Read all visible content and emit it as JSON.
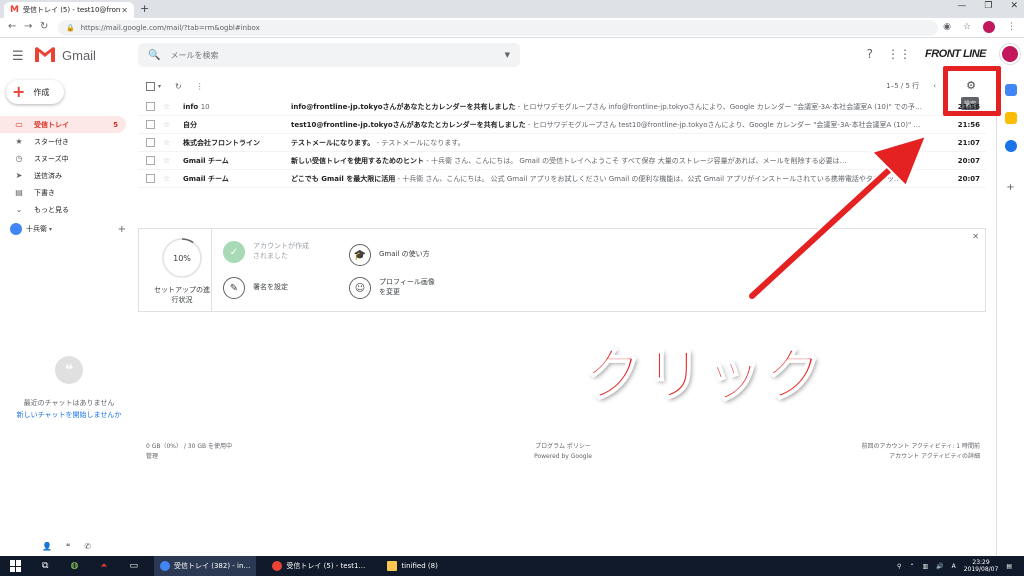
{
  "browser": {
    "tab_title": "受信トレイ (5) - test10@frontline-",
    "tab_favicon": "M",
    "url": "https://mail.google.com/mail/?tab=rm&ogbl#inbox"
  },
  "header": {
    "app_name": "Gmail",
    "search_placeholder": "メールを検索",
    "brand": "FRONT LINE"
  },
  "sidebar": {
    "compose_label": "作成",
    "items": [
      {
        "label": "受信トレイ",
        "count": "5",
        "icon": "inbox-icon",
        "glyph": "▭"
      },
      {
        "label": "スター付き",
        "count": "",
        "icon": "star-icon",
        "glyph": "★"
      },
      {
        "label": "スヌーズ中",
        "count": "",
        "icon": "clock-icon",
        "glyph": "◷"
      },
      {
        "label": "送信済み",
        "count": "",
        "icon": "send-icon",
        "glyph": "➤"
      },
      {
        "label": "下書き",
        "count": "",
        "icon": "draft-icon",
        "glyph": "▤"
      },
      {
        "label": "もっと見る",
        "count": "",
        "icon": "chevron-down-icon",
        "glyph": "⌄"
      }
    ],
    "hangouts_user": "十兵衛",
    "chat_empty": "最近のチャットはありません",
    "chat_start": "新しいチャットを開始しませんか"
  },
  "toolbar": {
    "pager": "1–5 / 5 行",
    "settings_tooltip": "設定"
  },
  "emails": [
    {
      "sender": "info",
      "count": "10",
      "subject": "info@frontline-jp.tokyoさんがあなたとカレンダーを共有しました",
      "snippet": " - ヒロサワデモグループさん info@frontline-jp.tokyoさんにより、Google カレンダー \"会議室-3A-本社会議室A (10)\" での予…",
      "time": "21:56"
    },
    {
      "sender": "自分",
      "count": "",
      "subject": "test10@frontline-jp.tokyoさんがあなたとカレンダーを共有しました",
      "snippet": " - ヒロサワデモグループさん test10@frontline-jp.tokyoさんにより、Google カレンダー \"会議室-3A-本社会議室A (10)\" …",
      "time": "21:56"
    },
    {
      "sender": "株式会社フロントライン",
      "count": "",
      "subject": "テストメールになります。",
      "snippet": " - テストメールになります。",
      "time": "21:07"
    },
    {
      "sender": "Gmail チーム",
      "count": "",
      "subject": "新しい受信トレイを使用するためのヒント",
      "snippet": " - 十兵衛 さん、こんにちは。 Gmail の受信トレイへようこそ すべて保存 大量のストレージ容量があれば、メールを削除する必要は…",
      "time": "20:07"
    },
    {
      "sender": "Gmail チーム",
      "count": "",
      "subject": "どこでも Gmail を最大限に活用",
      "snippet": " - 十兵衛 さん、こんにちは。 公式 Gmail アプリをお試しください Gmail の便利な機能は、公式 Gmail アプリがインストールされている携帯電話やタブレッ…",
      "time": "20:07"
    }
  ],
  "setup": {
    "progress": 0.1,
    "progress_label": "10%",
    "caption": "セットアップの進行状況",
    "tasks": [
      {
        "label": "アカウントが作成されました",
        "icon": "check-icon",
        "glyph": "✓",
        "done": true
      },
      {
        "label": "Gmail の使い方",
        "icon": "graduation-cap-icon",
        "glyph": "🎓",
        "done": false
      },
      {
        "label": "署名を設定",
        "icon": "pen-icon",
        "glyph": "✎",
        "done": false
      },
      {
        "label": "プロフィール画像を変更",
        "icon": "person-icon",
        "glyph": "☺",
        "done": false
      }
    ]
  },
  "footer": {
    "storage": "0 GB（0%） / 30 GB を使用中",
    "manage": "管理",
    "policy": "プログラム ポリシー",
    "powered": "Powered by Google",
    "activity": "前回のアカウント アクティビティ: 1 時間前",
    "activity_detail": "アカウント アクティビティの詳細"
  },
  "annotation": {
    "text": "クリック",
    "color": "#e52222"
  },
  "taskbar": {
    "apps": [
      {
        "label": "受信トレイ (382) - in…"
      },
      {
        "label": "受信トレイ (5) - test1…"
      },
      {
        "label": "tinified (8)"
      }
    ],
    "time": "23:29",
    "date": "2019/08/07"
  },
  "colors": {
    "accent_red": "#d93025",
    "gmail_red": "#ea4335",
    "link_blue": "#1a73e8"
  }
}
